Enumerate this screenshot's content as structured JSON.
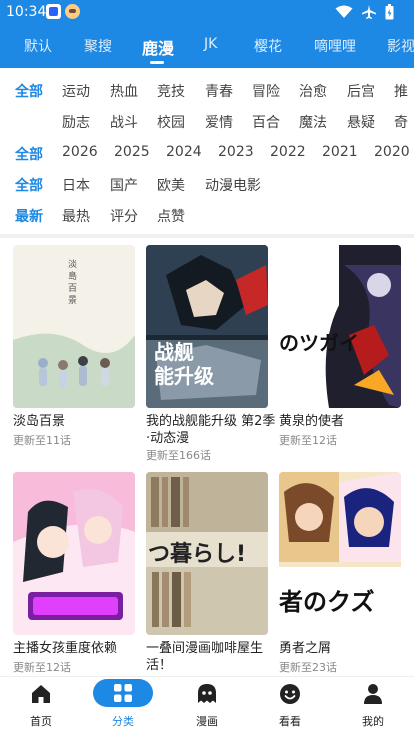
{
  "status_bar": {
    "time": "10:34",
    "icons": [
      "notification-app-icon",
      "notification-avatar-icon",
      "wifi-icon",
      "airplane-mode-icon",
      "battery-icon"
    ]
  },
  "tabs": [
    {
      "label": "默认",
      "active": false
    },
    {
      "label": "聚搜",
      "active": false
    },
    {
      "label": "鹿漫",
      "active": true
    },
    {
      "label": "JK",
      "active": false
    },
    {
      "label": "樱花",
      "active": false
    },
    {
      "label": "嘀哩哩",
      "active": false
    },
    {
      "label": "影视",
      "active": false
    }
  ],
  "filters": {
    "genre": {
      "all": "全部",
      "row1": [
        "运动",
        "热血",
        "竞技",
        "青春",
        "冒险",
        "治愈",
        "后宫",
        "推"
      ],
      "row2": [
        "励志",
        "战斗",
        "校园",
        "爱情",
        "百合",
        "魔法",
        "悬疑",
        "奇"
      ]
    },
    "year": {
      "all": "全部",
      "items": [
        "2026",
        "2025",
        "2024",
        "2023",
        "2022",
        "2021",
        "2020"
      ]
    },
    "region": {
      "all": "全部",
      "items": [
        "日本",
        "国产",
        "欧美",
        "动漫电影"
      ]
    },
    "sort": {
      "selected": "最新",
      "items": [
        "最热",
        "评分",
        "点赞"
      ]
    }
  },
  "cards": [
    {
      "title": "淡岛百景",
      "subtitle": "更新至11话",
      "poster_text": "淡\n島\n百\n景"
    },
    {
      "title": "我的战舰能升级 第2季·动态漫",
      "subtitle": "更新至166话",
      "poster_text": "战舰\n能升级"
    },
    {
      "title": "黄泉的使者",
      "subtitle": "更新至12话",
      "poster_text": "のツガイ"
    },
    {
      "title": "主播女孩重度依赖",
      "subtitle": "更新至12话",
      "poster_text": ""
    },
    {
      "title": "一叠间漫画咖啡屋生活！",
      "subtitle": "更新至12话",
      "poster_text": "つ暮らし!"
    },
    {
      "title": "勇者之屑",
      "subtitle": "更新至23话",
      "poster_text": "者のクズ"
    }
  ],
  "bottom_nav": [
    {
      "label": "首页",
      "icon": "home-icon",
      "active": false
    },
    {
      "label": "分类",
      "icon": "category-grid-icon",
      "active": true
    },
    {
      "label": "漫画",
      "icon": "ghost-icon",
      "active": false
    },
    {
      "label": "看看",
      "icon": "smile-face-icon",
      "active": false
    },
    {
      "label": "我的",
      "icon": "profile-icon",
      "active": false
    }
  ],
  "colors": {
    "primary": "#1e88e5",
    "text": "#444444",
    "subtext": "#888888"
  }
}
